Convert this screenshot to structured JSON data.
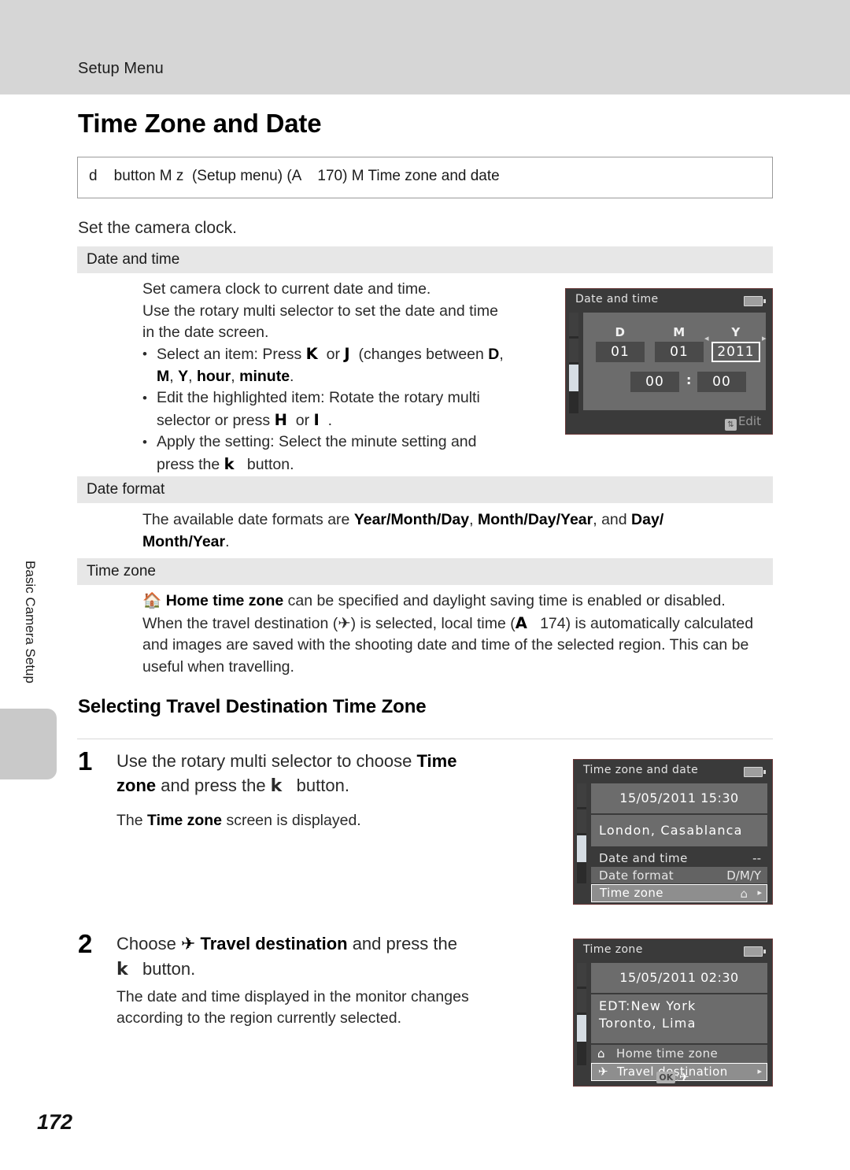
{
  "header": {
    "running_head": "Setup Menu"
  },
  "side_tab": {
    "label": "Basic Camera Setup"
  },
  "page": {
    "number": "172"
  },
  "title": "Time Zone and Date",
  "breadcrumb": {
    "text": "d    button M z  (Setup menu) (A    170) M Time zone and date"
  },
  "intro": "Set the camera clock.",
  "sections": {
    "date_and_time": {
      "heading": "Date and time",
      "lines": [
        "Set camera clock to current date and time.",
        "Use the rotary multi selector to set the date and time",
        "in the date screen."
      ],
      "bullets": [
        "Select an item: Press K  or J   (changes between D, M, Y, hour, minute.",
        "Edit the highlighted item: Rotate the rotary multi selector or press H  or I  .",
        "Apply the setting: Select the minute setting and press the k   button."
      ]
    },
    "date_format": {
      "heading": "Date format",
      "body": "The available date formats are Year/Month/Day, Month/Day/Year, and Day/Month/Year."
    },
    "time_zone": {
      "heading": "Time zone",
      "body": "Home time zone can be specified and daylight saving time is enabled or disabled. When the travel destination (✈) is selected, local time (A    174) is automatically calculated and images are saved with the shooting date and time of the selected region. This can be useful when travelling."
    }
  },
  "subsection": {
    "heading": "Selecting Travel Destination Time Zone",
    "steps": [
      {
        "num": "1",
        "text": "Use the rotary multi selector to choose Time zone and press the k   button.",
        "sub": "The Time zone screen is displayed."
      },
      {
        "num": "2",
        "text": "Choose ✈ Travel destination and press the k   button.",
        "sub": "The date and time displayed in the monitor changes according to the region currently selected."
      }
    ]
  },
  "screens": {
    "date_time": {
      "title": "Date and time",
      "columns": [
        {
          "label": "D",
          "value": "01",
          "selected": false
        },
        {
          "label": "M",
          "value": "01",
          "selected": false
        },
        {
          "label": "Y",
          "value": "2011",
          "selected": true
        }
      ],
      "hour": "00",
      "separator": ":",
      "minute": "00",
      "footer_label": "Edit"
    },
    "time_zone_and_date": {
      "title": "Time zone and date",
      "clock": "15/05/2011 15:30",
      "city": "London, Casablanca",
      "rows": [
        {
          "label": "Date and time",
          "value": "--",
          "highlighted": false
        },
        {
          "label": "Date format",
          "value": "D/M/Y",
          "highlighted": false
        },
        {
          "label": "Time zone",
          "value": "⌂",
          "highlighted": true
        }
      ]
    },
    "time_zone": {
      "title": "Time zone",
      "clock": "15/05/2011 02:30",
      "zone_line1": "EDT:New York",
      "zone_line2": "Toronto, Lima",
      "options": [
        {
          "icon": "⌂",
          "label": "Home time zone",
          "highlighted": false
        },
        {
          "icon": "✈",
          "label": "Travel destination",
          "highlighted": true
        }
      ],
      "footer_ok": "OK",
      "footer_sep": ":",
      "footer_icon": "✈"
    }
  },
  "colors": {
    "header_band": "#d6d6d6",
    "section_band": "#e7e7e7",
    "lcd_frame": "#3a3a3a",
    "lcd_panel": "#6c6c6c",
    "highlight_border": "#ffffff"
  }
}
